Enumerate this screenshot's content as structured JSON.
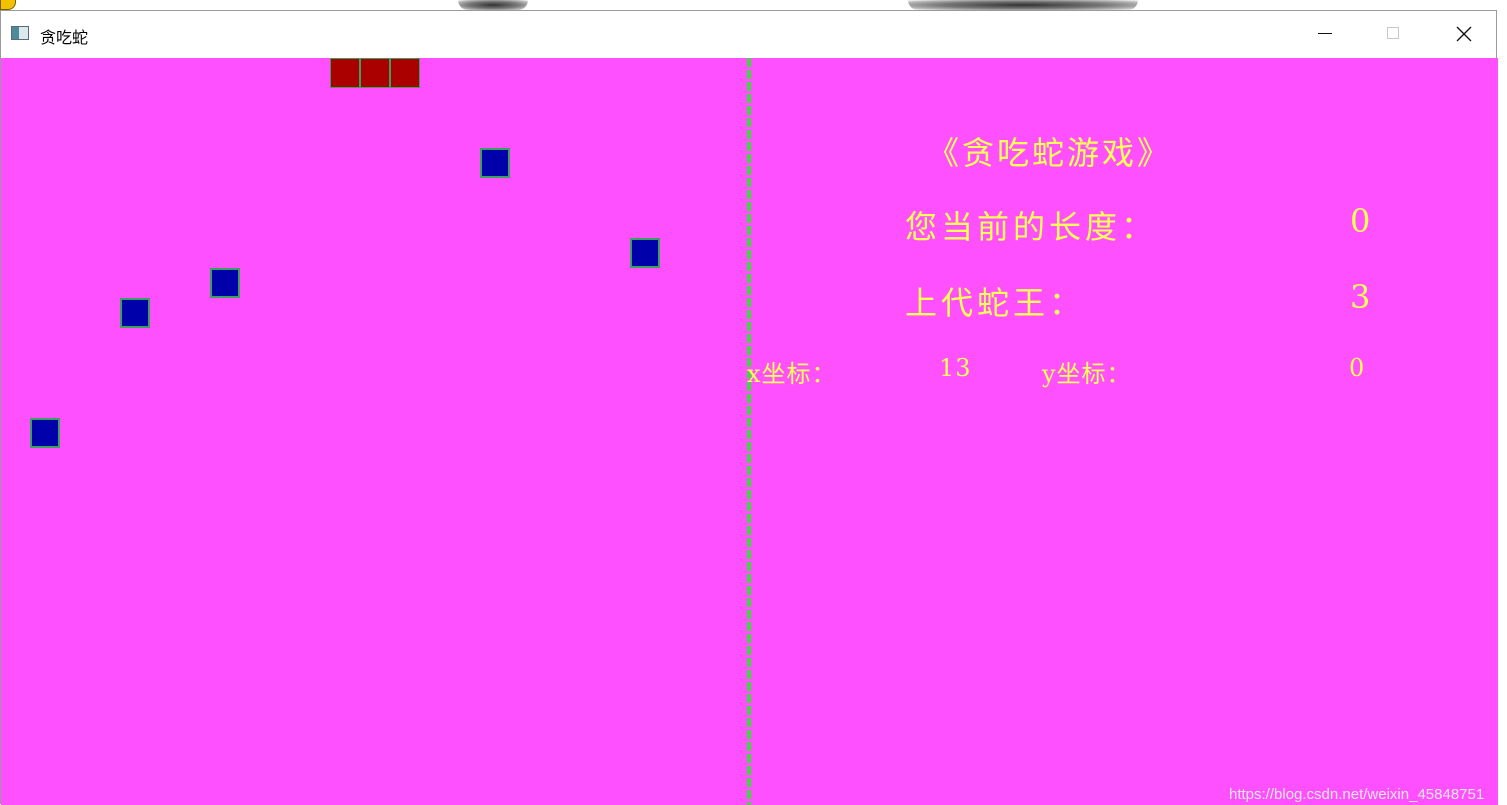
{
  "window": {
    "title": "贪吃蛇",
    "buttons": {
      "minimize": "minimize-icon",
      "maximize": "maximize-icon",
      "close": "close-icon"
    }
  },
  "hud": {
    "title": "《贪吃蛇游戏》",
    "length_label": "您当前的长度：",
    "length_value": "0",
    "king_label": "上代蛇王：",
    "king_value": "3",
    "x_label": "x坐标：",
    "x_value": "13",
    "y_label": "y坐标：",
    "y_value": "0"
  },
  "colors": {
    "background": "#ff50ff",
    "text": "#ffff55",
    "food": "#0000aa",
    "snake": "#aa0000",
    "divider": "#40d840"
  },
  "watermark": "https://blog.csdn.net/weixin_45848751"
}
